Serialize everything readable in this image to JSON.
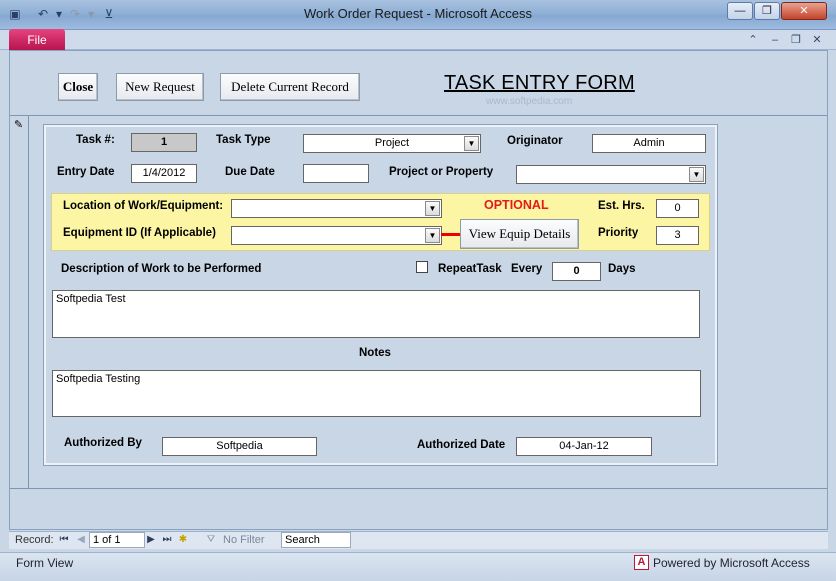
{
  "window": {
    "title": "Work Order Request  -  Microsoft Access",
    "controls": {
      "minimize": "—",
      "restore": "❐",
      "close": "✕"
    }
  },
  "ribbon": {
    "file_tab": "File"
  },
  "form": {
    "buttons": {
      "close": "Close",
      "new_request": "New Request",
      "delete_record": "Delete Current Record"
    },
    "title": "TASK ENTRY FORM",
    "watermark": "www.softpedia.com",
    "fields": {
      "task_no": {
        "label": "Task #:",
        "value": "1"
      },
      "task_type": {
        "label": "Task Type",
        "value": "Project"
      },
      "originator": {
        "label": "Originator",
        "value": "Admin"
      },
      "entry_date": {
        "label": "Entry  Date",
        "value": "1/4/2012"
      },
      "due_date": {
        "label": "Due Date",
        "value": ""
      },
      "project_property": {
        "label": "Project or Property",
        "value": ""
      },
      "location": {
        "label": "Location of Work/Equipment:",
        "value": ""
      },
      "equipment_id": {
        "label": "Equipment ID (If Applicable)",
        "value": ""
      },
      "optional": "OPTIONAL",
      "view_equip_button": "View Equip Details",
      "est_hrs": {
        "label": "Est. Hrs.",
        "value": "0"
      },
      "priority": {
        "label": "Priority",
        "value": "3"
      },
      "description": {
        "label": "Description of Work to be Performed",
        "value": "Softpedia Test"
      },
      "repeat": {
        "label": "RepeatTask",
        "every_label": "Every",
        "value": "0",
        "days_label": "Days",
        "checked": false
      },
      "notes": {
        "label": "Notes",
        "value": "Softpedia Testing"
      },
      "authorized_by": {
        "label": "Authorized By",
        "value": "Softpedia"
      },
      "authorized_date": {
        "label": "Authorized Date",
        "value": "04-Jan-12"
      }
    }
  },
  "navigation": {
    "record_label": "Record:",
    "position": "1 of 1",
    "filter": "No Filter",
    "search_placeholder": "Search"
  },
  "status": {
    "left": "Form View",
    "right": "Powered by Microsoft Access"
  },
  "colors": {
    "file_tab": "#c0185a",
    "optional": "#e21b1b",
    "band": "#fcf6a4",
    "form_bg": "#c9d6e6"
  }
}
